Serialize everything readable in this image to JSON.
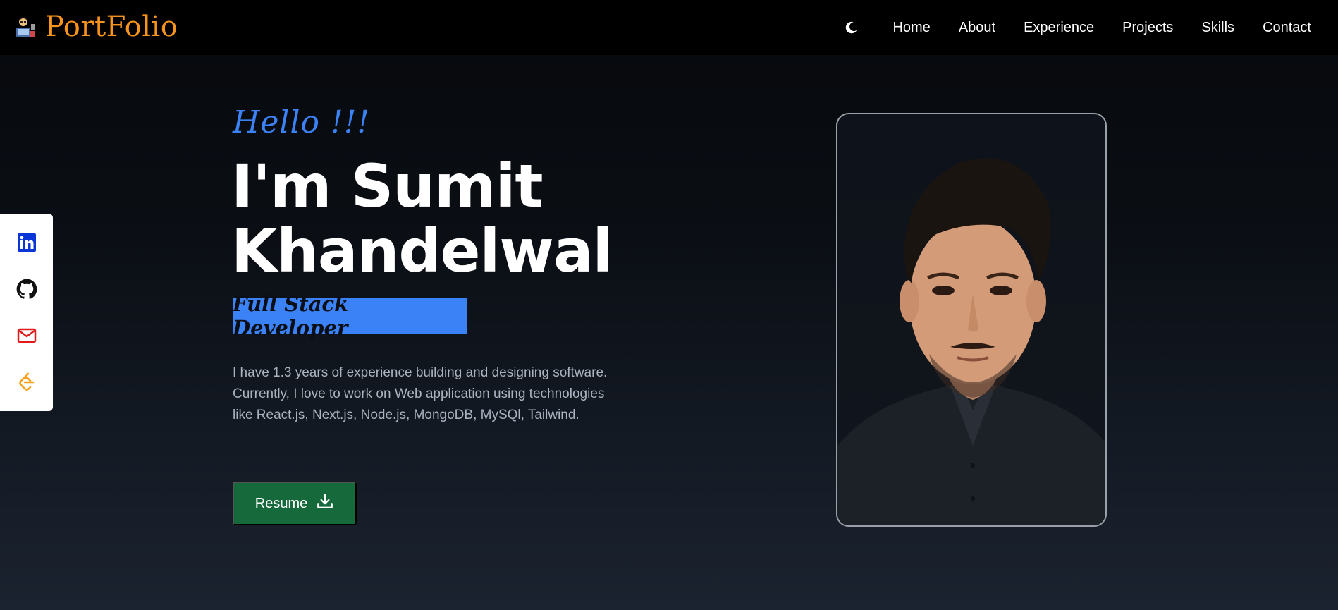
{
  "navbar": {
    "brand": "PortFolio",
    "links": [
      "Home",
      "About",
      "Experience",
      "Projects",
      "Skills",
      "Contact"
    ]
  },
  "social": [
    {
      "name": "linkedin",
      "icon": "linkedin-icon",
      "color": "#0a36d8"
    },
    {
      "name": "github",
      "icon": "github-icon",
      "color": "#111111"
    },
    {
      "name": "email",
      "icon": "mail-icon",
      "color": "#e21c1c"
    },
    {
      "name": "leetcode",
      "icon": "leetcode-icon",
      "color": "#f7a21b"
    }
  ],
  "hero": {
    "greeting": "Hello !!!",
    "name_line1": "I'm Sumit",
    "name_line2": "Khandelwal",
    "role": "Full Stack Developer",
    "bio": "I have 1.3 years of experience building and designing software. Currently, I love to work on Web application using technologies like React.js, Next.js, Node.js, MongoDB, MySQl, Tailwind.",
    "resume_label": "Resume"
  },
  "colors": {
    "brand": "#f7941d",
    "accent": "#3b82f6",
    "resume_bg": "#15693a"
  }
}
